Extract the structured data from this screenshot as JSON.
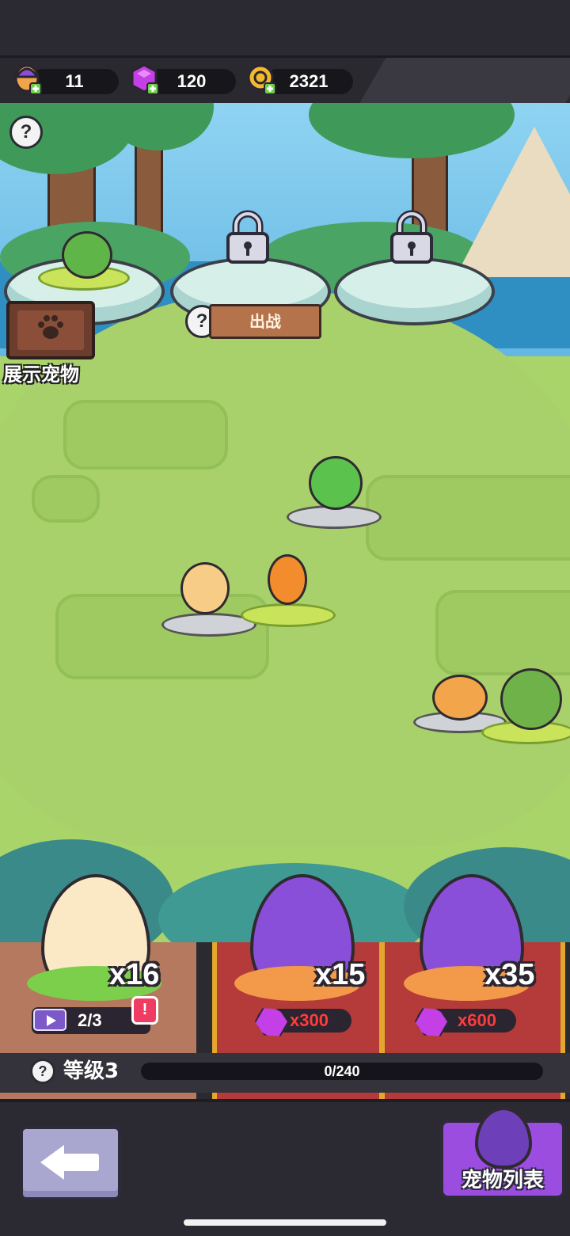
{
  "currencies": [
    {
      "name": "eggs",
      "value": "11",
      "color": "#8a4fd8"
    },
    {
      "name": "gems",
      "value": "120",
      "color": "#c43fe6"
    },
    {
      "name": "coins",
      "value": "2321",
      "color": "#f2b92f"
    }
  ],
  "scene": {
    "help_icon": "question-icon",
    "deploy_label": "出战",
    "showcase_label": "展示宠物",
    "locked_slots": 2
  },
  "eggs": [
    {
      "count": "x16",
      "ad_progress": "2/3",
      "alert": "!"
    },
    {
      "count": "x15",
      "price": "x300"
    },
    {
      "count": "x35",
      "price": "x600"
    }
  ],
  "level": {
    "label": "等级3",
    "xp": "0/240"
  },
  "nav": {
    "pet_list_label": "宠物列表"
  },
  "colors": {
    "accent_purple": "#9b4de0",
    "price_red": "#ff3b3b",
    "grass": "#a8d16b"
  }
}
